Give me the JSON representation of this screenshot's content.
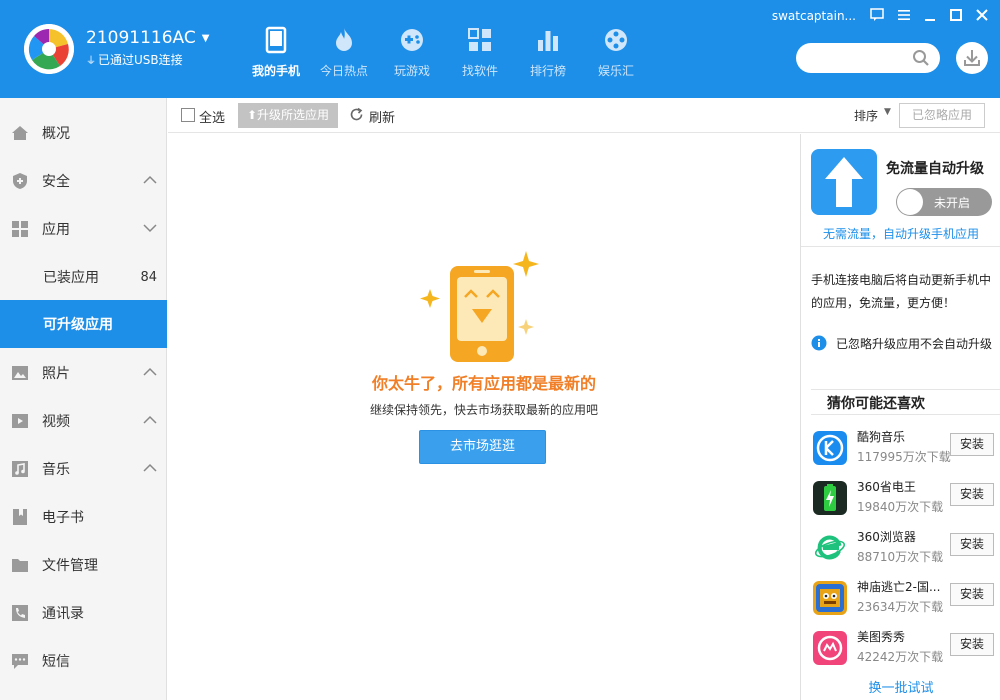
{
  "header": {
    "device_name": "21091116AC",
    "usb_status": "已通过USB连接",
    "username": "swatcaptain...",
    "nav": [
      {
        "label": "我的手机",
        "icon": "phone-icon"
      },
      {
        "label": "今日热点",
        "icon": "flame-icon"
      },
      {
        "label": "玩游戏",
        "icon": "gamepad-icon"
      },
      {
        "label": "找软件",
        "icon": "apps-grid-icon"
      },
      {
        "label": "排行榜",
        "icon": "bar-chart-icon"
      },
      {
        "label": "娱乐汇",
        "icon": "film-reel-icon"
      }
    ],
    "brand_color": "#1d8fe9"
  },
  "sidebar": {
    "items": [
      {
        "label": "概况",
        "icon": "home-icon"
      },
      {
        "label": "安全",
        "icon": "shield-icon"
      },
      {
        "label": "应用",
        "icon": "apps-icon"
      },
      {
        "label": "已装应用",
        "count": "84"
      },
      {
        "label": "可升级应用"
      },
      {
        "label": "照片",
        "icon": "photo-icon"
      },
      {
        "label": "视频",
        "icon": "video-icon"
      },
      {
        "label": "音乐",
        "icon": "music-icon"
      },
      {
        "label": "电子书",
        "icon": "book-icon"
      },
      {
        "label": "文件管理",
        "icon": "folder-icon"
      },
      {
        "label": "通讯录",
        "icon": "phone-book-icon"
      },
      {
        "label": "短信",
        "icon": "sms-icon"
      }
    ]
  },
  "toolbar": {
    "select_all": "全选",
    "upgrade_selected": "升级所选应用",
    "refresh": "刷新",
    "sort": "排序",
    "ignored": "已忽略应用"
  },
  "main": {
    "empty_title": "你太牛了，所有应用都是最新的",
    "empty_subtitle": "继续保持领先，快去市场获取最新的应用吧",
    "go_market": "去市场逛逛"
  },
  "right_panel": {
    "auto_title": "免流量自动升级",
    "toggle_label": "未开启",
    "auto_desc": "无需流量，自动升级手机应用",
    "info_text": "手机连接电脑后将自动更新手机中的应用，免流量，更方便！",
    "note": "已忽略升级应用不会自动升级",
    "rec_title": "猜你可能还喜欢",
    "install_label": "安装",
    "apps": [
      {
        "name": "酷狗音乐",
        "downloads": "117995万次下载",
        "color": "#1a8cf0"
      },
      {
        "name": "360省电王",
        "downloads": "19840万次下载",
        "color": "#1c2a24"
      },
      {
        "name": "360浏览器",
        "downloads": "88710万次下载",
        "color": "#ffffff"
      },
      {
        "name": "神庙逃亡2-国...",
        "downloads": "23634万次下载",
        "color": "#e8a317"
      },
      {
        "name": "美图秀秀",
        "downloads": "42242万次下载",
        "color": "#f0447a"
      }
    ],
    "more": "换一批试试"
  }
}
